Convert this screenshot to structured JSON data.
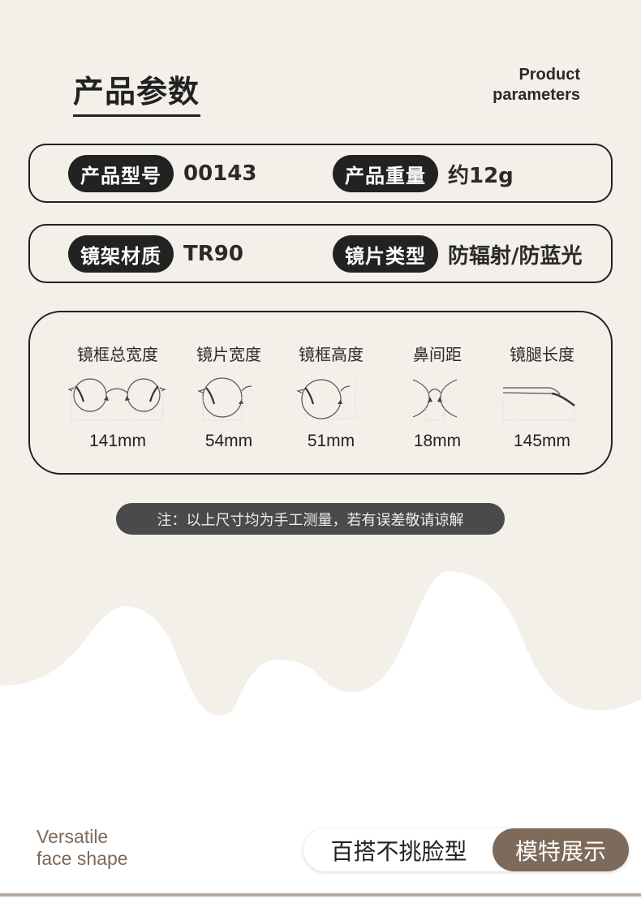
{
  "header": {
    "title_cn": "产品参数",
    "title_en_line1": "Product",
    "title_en_line2": "parameters"
  },
  "specs": [
    {
      "left": {
        "label": "产品型号",
        "value": "00143"
      },
      "right": {
        "label": "产品重量",
        "value": "约12g"
      }
    },
    {
      "left": {
        "label": "镜架材质",
        "value": "TR90"
      },
      "right": {
        "label": "镜片类型",
        "value": "防辐射/防蓝光"
      }
    }
  ],
  "measurements": [
    {
      "label": "镜框总宽度",
      "value": "141mm",
      "icon": "full-frame-width-icon"
    },
    {
      "label": "镜片宽度",
      "value": "54mm",
      "icon": "lens-width-icon"
    },
    {
      "label": "镜框高度",
      "value": "51mm",
      "icon": "frame-height-icon"
    },
    {
      "label": "鼻间距",
      "value": "18mm",
      "icon": "bridge-width-icon"
    },
    {
      "label": "镜腿长度",
      "value": "145mm",
      "icon": "temple-length-icon"
    }
  ],
  "note": "注：以上尺寸均为手工测量，若有误差敬请谅解",
  "footer": {
    "en_line1": "Versatile",
    "en_line2": "face shape",
    "toggle_off_label": "百搭不挑脸型",
    "toggle_on_label": "模特展示"
  },
  "colors": {
    "background": "#f3efe9",
    "dark": "#222222",
    "accent_brown": "#7e6a5a",
    "note_bg": "#4a4a4a",
    "divider": "#b3a89e"
  }
}
